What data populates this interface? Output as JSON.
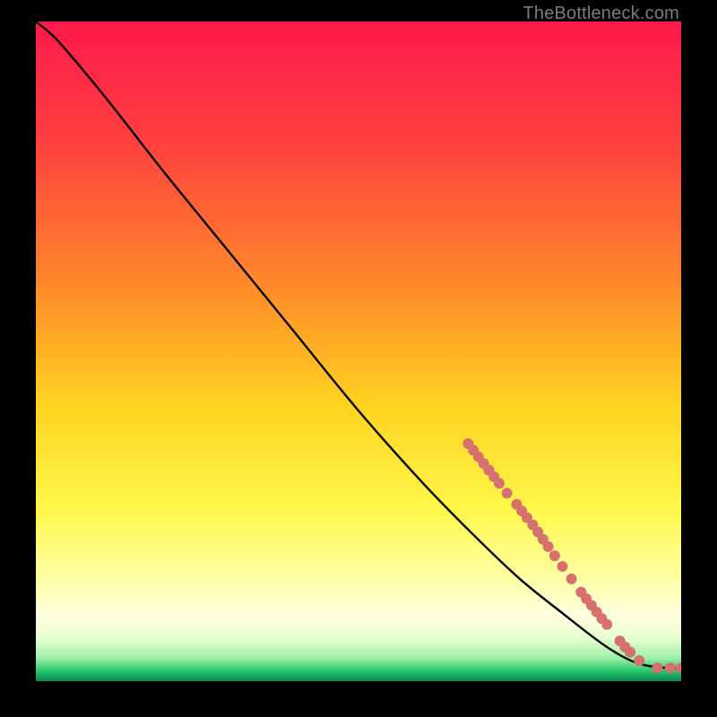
{
  "watermark": "TheBottleneck.com",
  "chart_data": {
    "type": "line",
    "title": "",
    "xlabel": "",
    "ylabel": "",
    "xlim": [
      0,
      100
    ],
    "ylim": [
      0,
      100
    ],
    "gradient_stops": [
      {
        "offset": 0,
        "color": "#ff1a4b"
      },
      {
        "offset": 0.18,
        "color": "#ff3f3f"
      },
      {
        "offset": 0.4,
        "color": "#ff8a2a"
      },
      {
        "offset": 0.58,
        "color": "#ffd21f"
      },
      {
        "offset": 0.74,
        "color": "#fff84a"
      },
      {
        "offset": 0.84,
        "color": "#ffffa0"
      },
      {
        "offset": 0.9,
        "color": "#ffffe0"
      },
      {
        "offset": 0.935,
        "color": "#e9ffd0"
      },
      {
        "offset": 0.965,
        "color": "#9ef0a8"
      },
      {
        "offset": 0.985,
        "color": "#25c56a"
      },
      {
        "offset": 1.0,
        "color": "#0b8a4e"
      }
    ],
    "curve": {
      "description": "Monotone decreasing curve from top-left, slight initial convex, long near-linear descent, flattening at far right near y≈2",
      "points_xy": [
        [
          0.0,
          100.0
        ],
        [
          3.0,
          97.5
        ],
        [
          7.0,
          93.0
        ],
        [
          12.0,
          87.0
        ],
        [
          20.0,
          77.0
        ],
        [
          30.0,
          65.0
        ],
        [
          40.0,
          53.0
        ],
        [
          50.0,
          41.0
        ],
        [
          60.0,
          30.0
        ],
        [
          68.0,
          22.0
        ],
        [
          75.0,
          15.5
        ],
        [
          82.0,
          10.0
        ],
        [
          88.0,
          5.5
        ],
        [
          92.0,
          3.2
        ],
        [
          95.0,
          2.3
        ],
        [
          98.0,
          2.0
        ],
        [
          100.0,
          2.0
        ]
      ]
    },
    "markers": {
      "color": "#d6716f",
      "radius": 6,
      "points_xy": [
        [
          67.0,
          36.0
        ],
        [
          67.8,
          35.0
        ],
        [
          68.6,
          34.0
        ],
        [
          69.4,
          33.0
        ],
        [
          70.2,
          32.0
        ],
        [
          71.0,
          31.0
        ],
        [
          71.8,
          30.0
        ],
        [
          73.0,
          28.5
        ],
        [
          74.5,
          26.8
        ],
        [
          75.3,
          25.8
        ],
        [
          76.1,
          24.8
        ],
        [
          77.0,
          23.7
        ],
        [
          77.8,
          22.6
        ],
        [
          78.6,
          21.5
        ],
        [
          79.4,
          20.4
        ],
        [
          80.4,
          19.0
        ],
        [
          81.6,
          17.4
        ],
        [
          83.0,
          15.5
        ],
        [
          84.5,
          13.5
        ],
        [
          85.3,
          12.5
        ],
        [
          86.1,
          11.5
        ],
        [
          86.9,
          10.5
        ],
        [
          87.7,
          9.5
        ],
        [
          88.5,
          8.6
        ],
        [
          90.5,
          6.1
        ],
        [
          91.3,
          5.2
        ],
        [
          92.1,
          4.4
        ],
        [
          93.5,
          3.1
        ],
        [
          96.3,
          2.0
        ],
        [
          98.3,
          2.0
        ],
        [
          100.0,
          2.0
        ]
      ]
    }
  }
}
